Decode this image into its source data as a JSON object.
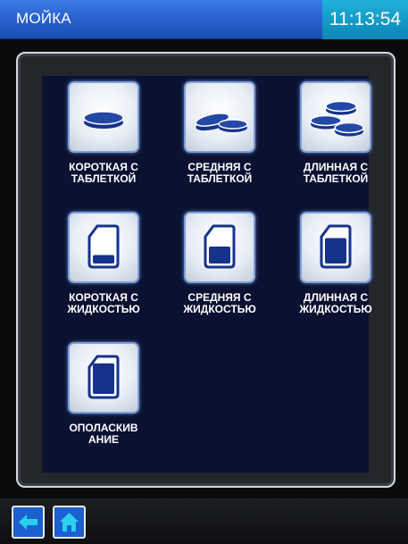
{
  "header": {
    "title": "МОЙКА",
    "time": "11:13:54"
  },
  "programs": [
    {
      "label": "КОРОТКАЯ С\nТАБЛЕТКОЙ",
      "icon": "tablet-one-icon"
    },
    {
      "label": "СРЕДНЯЯ С\nТАБЛЕТКОЙ",
      "icon": "tablet-two-icon"
    },
    {
      "label": "ДЛИННАЯ С\nТАБЛЕТКОЙ",
      "icon": "tablet-three-icon"
    },
    {
      "label": "КОРОТКАЯ С\nЖИДКОСТЬЮ",
      "icon": "canister-low-icon",
      "level": 0.25
    },
    {
      "label": "СРЕДНЯЯ С\nЖИДКОСТЬЮ",
      "icon": "canister-mid-icon",
      "level": 0.5
    },
    {
      "label": "ДЛИННАЯ С\nЖИДКОСТЬЮ",
      "icon": "canister-high-icon",
      "level": 0.75
    },
    {
      "label": "ОПОЛАСКИВ\nАНИЕ",
      "icon": "canister-full-icon",
      "level": 0.9
    }
  ],
  "nav": {
    "back_icon": "arrow-left-icon",
    "home_icon": "home-icon"
  },
  "colors": {
    "header": "#2a63cf",
    "clock": "#0b86b7",
    "panel": "#0b1130",
    "icon_fill": "#16338a",
    "nav_button": "#1c5fd0"
  }
}
